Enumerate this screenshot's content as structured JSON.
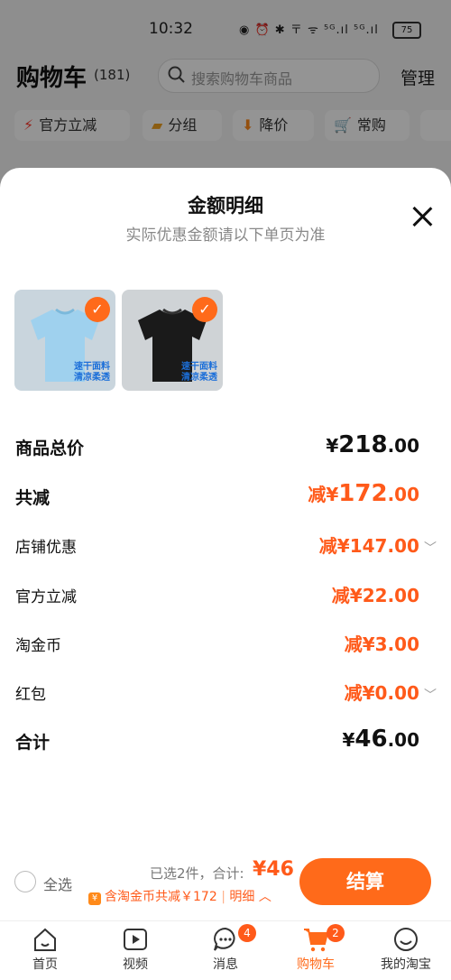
{
  "status_bar": {
    "time": "10:32",
    "indicators": "◉ ⏰ ✱ 〒 ᯤ ⁵ᴳ.ıl ⁵ᴳ.ıl",
    "battery": "75"
  },
  "cart_header": {
    "title": "购物车",
    "count": "(181)",
    "search_placeholder": "搜索购物车商品",
    "manage": "管理",
    "chips": [
      "官方立减",
      "分组",
      "降价",
      "常购"
    ]
  },
  "sheet": {
    "title": "金额明细",
    "subtitle": "实际优惠金额请以下单页为准",
    "products": [
      {
        "name": "light-blue-tshirt",
        "color": "#9fd1ee",
        "tag_line1": "速干面料",
        "tag_line2": "清凉柔透"
      },
      {
        "name": "black-tshirt",
        "color": "#1a1a1a",
        "tag_line1": "速干面料",
        "tag_line2": "清凉柔透"
      }
    ],
    "rows": {
      "total_price": {
        "label": "商品总价",
        "prefix": "¥",
        "int": "218",
        "dec": ".00"
      },
      "total_discount": {
        "label": "共减",
        "prefix": "减¥",
        "int": "172",
        "dec": ".00"
      },
      "store_coupon": {
        "label": "店铺优惠",
        "prefix": "减¥",
        "int": "147",
        "dec": ".00"
      },
      "official_discount": {
        "label": "官方立减",
        "prefix": "减¥",
        "int": "22",
        "dec": ".00"
      },
      "taojinbi": {
        "label": "淘金币",
        "prefix": "减¥",
        "int": "3",
        "dec": ".00"
      },
      "red_packet": {
        "label": "红包",
        "prefix": "减¥",
        "int": "0",
        "dec": ".00"
      },
      "sum": {
        "label": "合计",
        "prefix": "¥",
        "int": "46",
        "dec": ".00"
      }
    }
  },
  "bottom_bar": {
    "select_all": "全选",
    "selected_info": "已选2件，合计:",
    "total": "¥46",
    "coin_note": "含淘金币共减￥172",
    "detail": "明细",
    "checkout": "结算"
  },
  "tabbar": {
    "tabs": [
      {
        "label": "首页",
        "icon": "home-icon"
      },
      {
        "label": "视频",
        "icon": "video-icon"
      },
      {
        "label": "消息",
        "icon": "message-icon",
        "badge": "4"
      },
      {
        "label": "购物车",
        "icon": "cart-icon",
        "badge": "2",
        "active": true
      },
      {
        "label": "我的淘宝",
        "icon": "profile-icon"
      }
    ]
  },
  "colors": {
    "accent": "#ff6a1a",
    "discount": "#ff5a1a"
  }
}
